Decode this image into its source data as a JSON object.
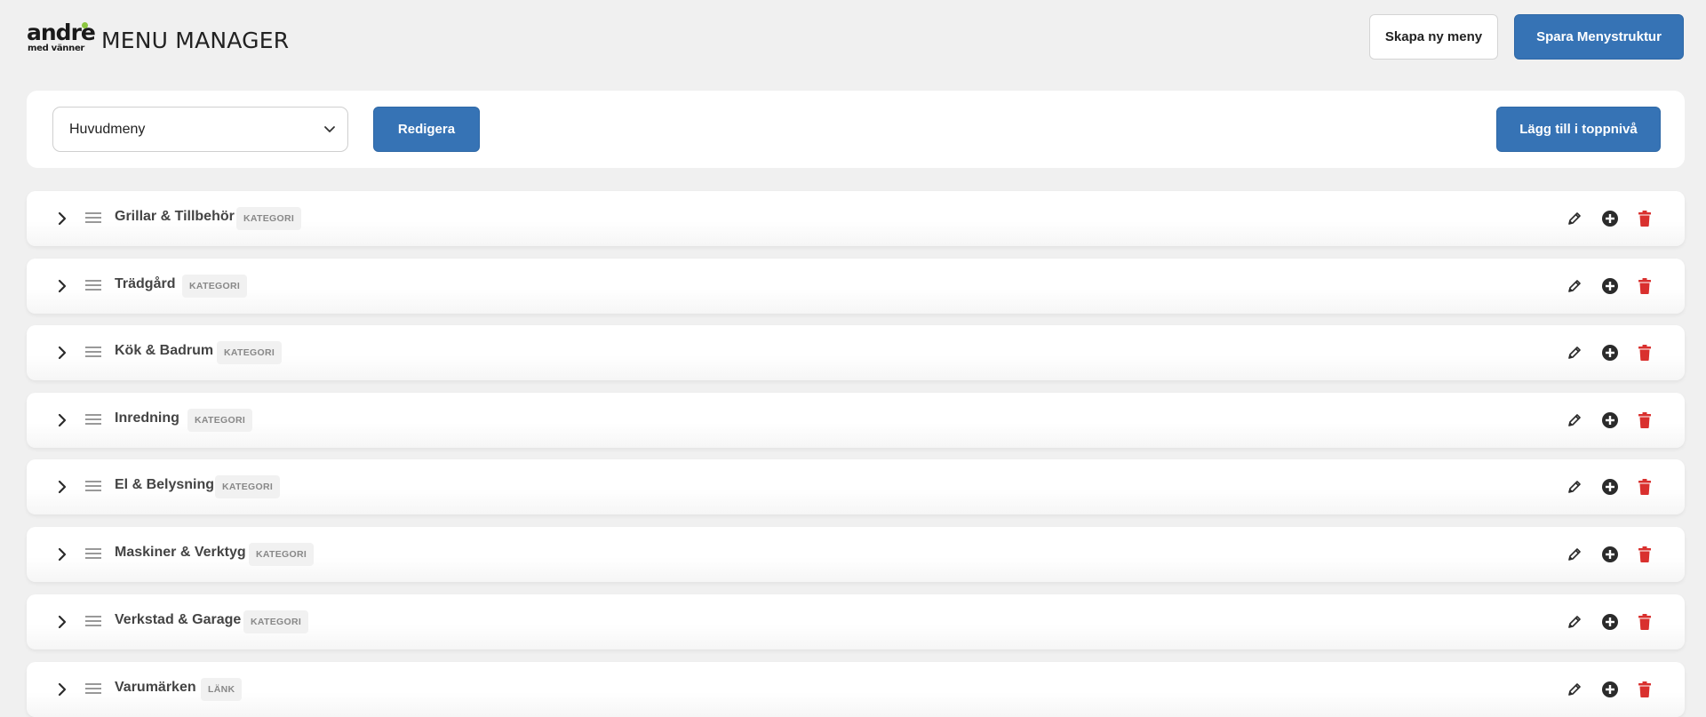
{
  "header": {
    "logo_main": "andre",
    "logo_sub": "med vänner",
    "title": "MENU MANAGER",
    "create_menu_label": "Skapa ny meny",
    "save_structure_label": "Spara Menystruktur"
  },
  "toolbar": {
    "menu_select_value": "Huvudmeny",
    "edit_label": "Redigera",
    "add_top_level_label": "Lägg till i toppnivå"
  },
  "menu_items": [
    {
      "label": "Grillar & Tillbehör",
      "type": "KATEGORI"
    },
    {
      "label": "Trädgård",
      "type": "KATEGORI"
    },
    {
      "label": "Kök & Badrum",
      "type": "KATEGORI"
    },
    {
      "label": "Inredning",
      "type": "KATEGORI"
    },
    {
      "label": "El & Belysning",
      "type": "KATEGORI"
    },
    {
      "label": "Maskiner & Verktyg",
      "type": "KATEGORI"
    },
    {
      "label": "Verkstad & Garage",
      "type": "KATEGORI"
    },
    {
      "label": "Varumärken",
      "type": "LÄNK"
    }
  ],
  "icons": {
    "expand": "chevron-right-icon",
    "drag": "drag-handle-icon",
    "edit": "pencil-icon",
    "add": "plus-circle-icon",
    "delete": "trash-icon"
  },
  "colors": {
    "primary": "#3673b5",
    "danger": "#d9302e",
    "background": "#f0f0f0",
    "logo_accent": "#8cc63f"
  }
}
